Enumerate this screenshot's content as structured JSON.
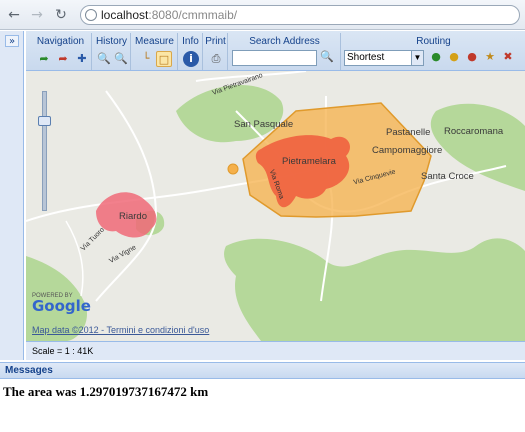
{
  "browser": {
    "url_host": "localhost",
    "url_rest": ":8080/cmmmaib/",
    "back_icon": "back-arrow-icon",
    "forward_icon": "forward-arrow-icon",
    "reload_icon": "reload-icon"
  },
  "toolbar": {
    "groups": {
      "navigation": "Navigation",
      "history": "History",
      "measure": "Measure",
      "info": "Info",
      "print": "Print",
      "search_address": "Search Address",
      "routing": "Routing"
    },
    "routing_select": {
      "selected": "Shortest"
    },
    "search_value": ""
  },
  "map": {
    "labels": {
      "san_pasquale": "San Pasquale",
      "pietramelara": "Pietramelara",
      "pastanelle": "Pastanelle",
      "roccaromana": "Roccaromana",
      "campomaggiore": "Campomaggiore",
      "santa_croce": "Santa Croce",
      "riardo": "Riardo",
      "via_cinquevie": "Via Cinquevie",
      "via_tuoro": "Via Tuoro",
      "via_vigne": "Via Vigne",
      "via_pietravairano": "Via Pietravairano",
      "via_roma": "Via Roma"
    },
    "powered_by": "POWERED BY",
    "google": "Google",
    "terms": "Map data ©2012 - Termini e condizioni d'uso"
  },
  "scale": {
    "text": "Scale = 1 : 41K"
  },
  "messages": {
    "title": "Messages",
    "text": "The area was 1.297019737167472 km"
  },
  "colors": {
    "polygon_fill": "#f5b04a",
    "polygon_stroke": "#e09a2c",
    "urban_red": "#ee5a3c",
    "urban_pink": "#f06a78",
    "green": "#b5d89a"
  }
}
